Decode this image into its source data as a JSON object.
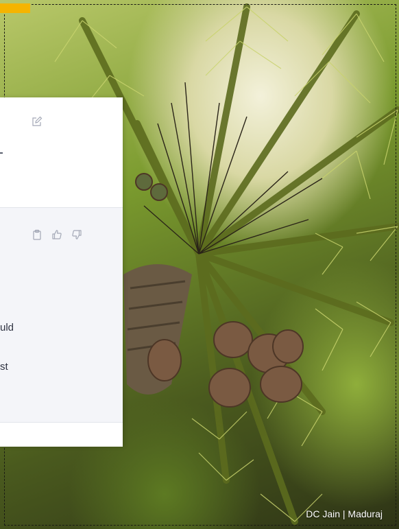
{
  "photo": {
    "credit": "DC Jain | Maduraj",
    "accent_color": "#f5b400"
  },
  "panel": {
    "user_message": {
      "edit_icon": "edit-icon"
    },
    "assistant_message": {
      "icons": [
        "clipboard-icon",
        "thumbs-up-icon",
        "thumbs-down-icon"
      ],
      "line_1": "uld",
      "line_2": "st"
    }
  }
}
